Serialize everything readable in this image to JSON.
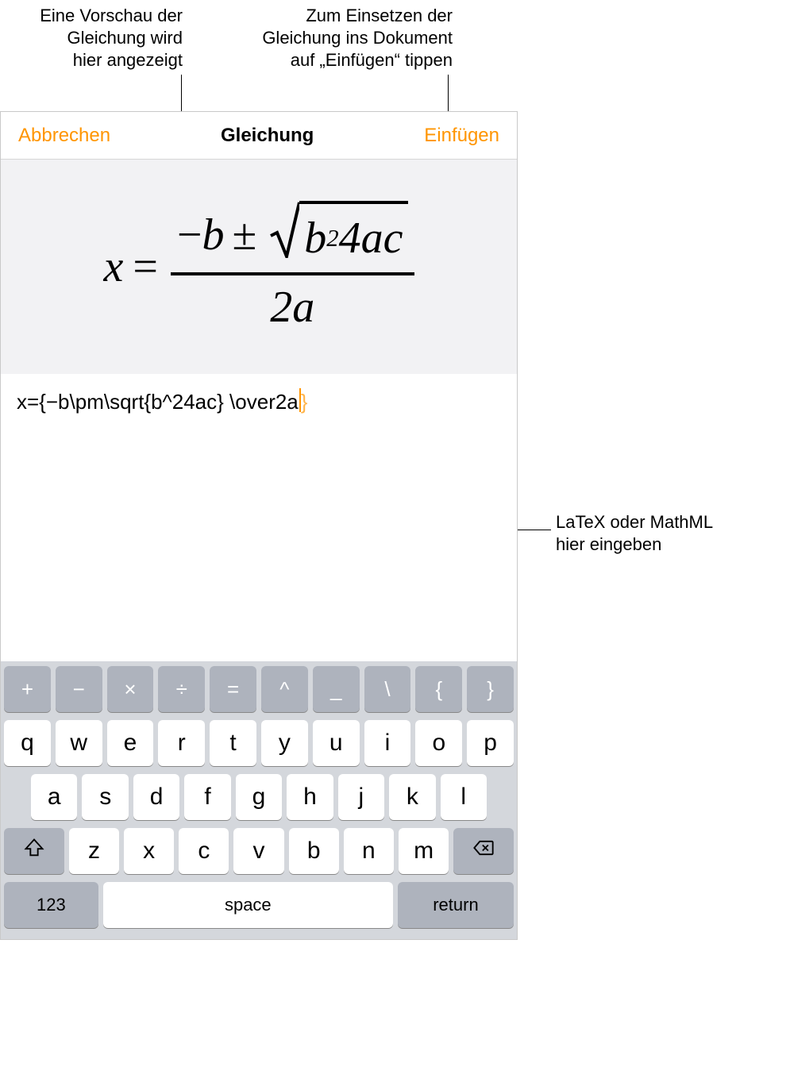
{
  "callouts": {
    "preview": {
      "l1": "Eine Vorschau der",
      "l2": "Gleichung wird",
      "l3": "hier angezeigt"
    },
    "insert": {
      "l1": "Zum Einsetzen der",
      "l2": "Gleichung ins Dokument",
      "l3": "auf „Einfügen“ tippen"
    },
    "latex": {
      "l1": "LaTeX oder MathML",
      "l2": "hier eingeben"
    }
  },
  "navbar": {
    "cancel": "Abbrechen",
    "title": "Gleichung",
    "insert": "Einfügen"
  },
  "equation_preview": {
    "lhs": "x",
    "eq": "=",
    "minus": "−",
    "b": "b",
    "pm": "±",
    "radicand_b": "b",
    "radicand_exp": "2",
    "radicand_rest": "4ac",
    "den": "2a"
  },
  "latex_input": {
    "value": "x={−b\\pm\\sqrt{b^24ac} \\over2a",
    "ghost": "}"
  },
  "keyboard": {
    "sym_row": [
      "+",
      "−",
      "×",
      "÷",
      "=",
      "^",
      "_",
      "\\",
      "{",
      "}"
    ],
    "row1": [
      "q",
      "w",
      "e",
      "r",
      "t",
      "y",
      "u",
      "i",
      "o",
      "p"
    ],
    "row2": [
      "a",
      "s",
      "d",
      "f",
      "g",
      "h",
      "j",
      "k",
      "l"
    ],
    "row3": [
      "z",
      "x",
      "c",
      "v",
      "b",
      "n",
      "m"
    ],
    "numbers": "123",
    "space": "space",
    "return": "return"
  }
}
